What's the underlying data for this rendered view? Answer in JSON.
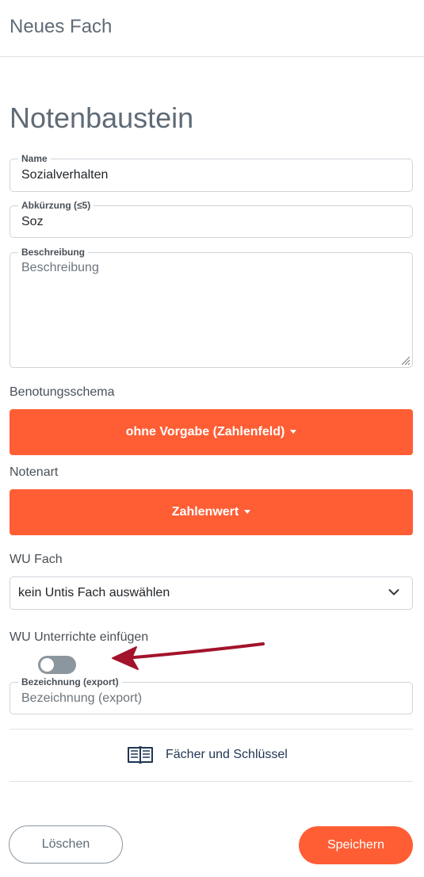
{
  "header": {
    "title": "Neues Fach"
  },
  "section": {
    "title": "Notenbaustein"
  },
  "fields": {
    "name": {
      "label": "Name",
      "value": "Sozialverhalten"
    },
    "abbreviation": {
      "label": "Abkürzung (≤5)",
      "value": "Soz"
    },
    "description": {
      "label": "Beschreibung",
      "placeholder": "Beschreibung"
    },
    "export_name": {
      "label": "Bezeichnung (export)",
      "placeholder": "Bezeichnung (export)"
    }
  },
  "grading_scheme": {
    "label": "Benotungsschema",
    "selected": "ohne Vorgabe (Zahlenfeld)"
  },
  "grade_type": {
    "label": "Notenart",
    "selected": "Zahlenwert"
  },
  "wu_subject": {
    "label": "WU Fach",
    "selected": "kein Untis Fach auswählen"
  },
  "wu_lessons": {
    "label": "WU Unterrichte einfügen",
    "toggle_on": false
  },
  "link": {
    "label": "Fächer und Schlüssel",
    "icon": "book-icon"
  },
  "actions": {
    "delete_label": "Löschen",
    "save_label": "Speichern"
  },
  "colors": {
    "accent": "#ff5e35",
    "arrow": "#a3132b",
    "toggle_off": "#8c969e"
  }
}
